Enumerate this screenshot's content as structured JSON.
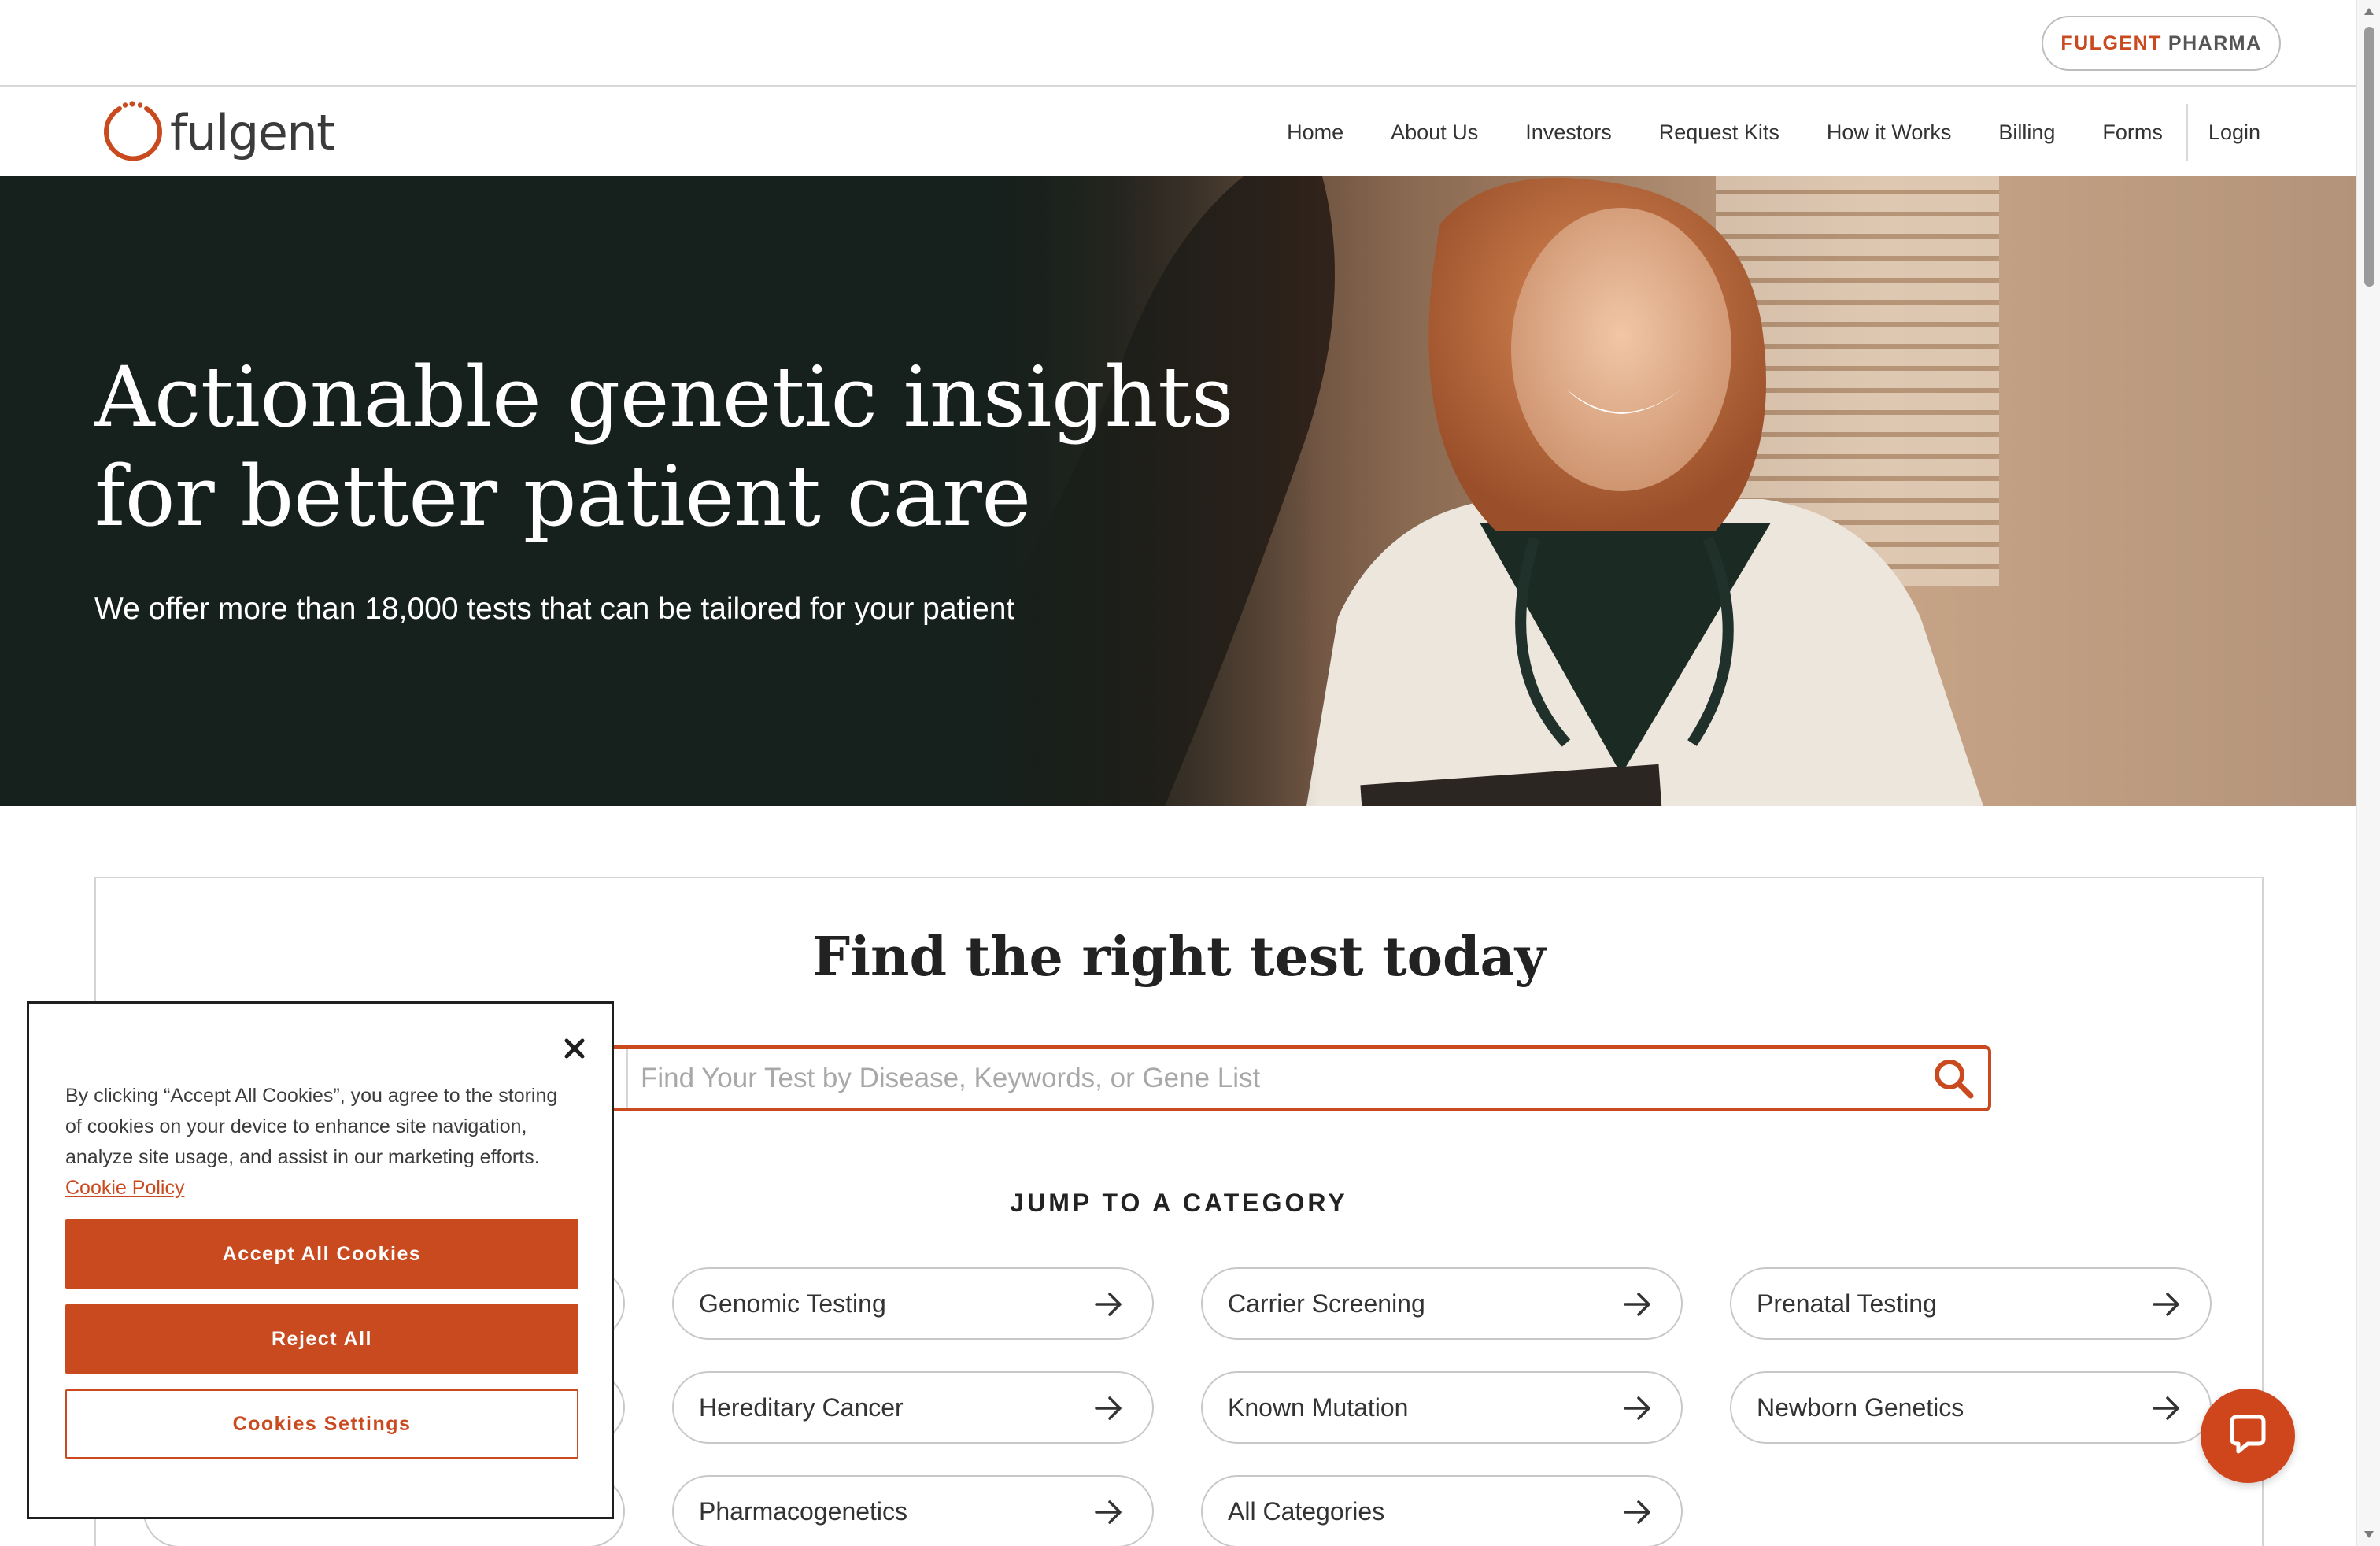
{
  "utility_bar": {
    "pharma_brand": "FULGENT",
    "pharma_word": "PHARMA"
  },
  "nav": {
    "logo_text": "fulgent",
    "links": [
      "Home",
      "About Us",
      "Investors",
      "Request Kits",
      "How it Works",
      "Billing",
      "Forms",
      "Login"
    ]
  },
  "hero": {
    "title_line1": "Actionable genetic insights",
    "title_line2": "for better patient care",
    "subtitle": "We offer more than 18,000 tests that can be tailored for your patient"
  },
  "finder": {
    "title": "Find the right test today",
    "search_placeholder": "Find Your Test by Disease, Keywords, or Gene List",
    "search_value": "",
    "jump_heading": "JUMP TO A CATEGORY",
    "categories": [
      "Genomic Testing",
      "Carrier Screening",
      "Prenatal Testing",
      "Hereditary Cancer",
      "Known Mutation",
      "Newborn Genetics",
      "Pharmacogenetics",
      "All Categories"
    ]
  },
  "cookie": {
    "text": "By clicking “Accept All Cookies”, you agree to the storing of cookies on your device to enhance site navigation, analyze site usage, and assist in our marketing efforts.",
    "policy_link": "Cookie Policy",
    "accept_label": "Accept All Cookies",
    "reject_label": "Reject All",
    "settings_label": "Cookies Settings"
  },
  "icons": {
    "logo": "fulgent-logo-icon",
    "search": "search-icon",
    "arrow": "arrow-right-icon",
    "close": "close-icon",
    "chat": "chat-icon",
    "dropdown": "chevron-down-icon"
  },
  "colors": {
    "brand": "#c94a1f",
    "hero_dark": "#16201c",
    "chat": "#d0461c"
  }
}
